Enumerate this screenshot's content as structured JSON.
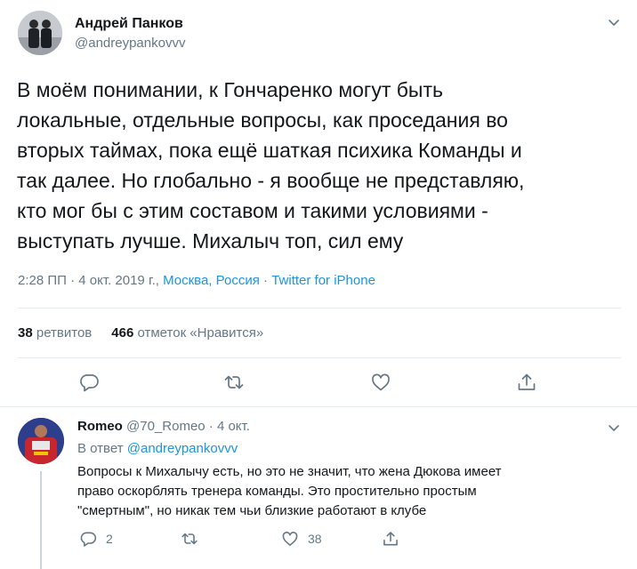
{
  "tweet": {
    "author_name": "Андрей Панков",
    "author_handle": "@andreypankovvv",
    "text": "В моём понимании, к Гончаренко могут быть\nлокальные, отдельные вопросы, как проседания во\nвторых таймах, пока ещё шаткая психика Команды и\nтак далее. Но глобально - я вообще не представляю,\nкто мог бы с этим составом и такими условиями -\nвыступать лучше. Михалыч топ, сил ему",
    "time": "2:28 ПП",
    "dot1": " · ",
    "date": "4 окт. 2019 г.,",
    "location": "Москва, Россия",
    "dot2": " · ",
    "source": "Twitter for iPhone",
    "retweets_count": "38",
    "retweets_label": "ретвитов",
    "likes_count": "466",
    "likes_label": "отметок «Нравится»"
  },
  "reply": {
    "author_name": "Romeo",
    "author_handle": "@70_Romeo",
    "date": "· 4 окт.",
    "in_reply_prefix": "В ответ",
    "in_reply_handle": "@andreypankovvv",
    "text": "Вопросы к Михалычу есть, но это не значит, что жена Дюкова имеет\nправо оскорблять тренера команды. Это простительно простым\n\"смертным\", но никак тем чьи близкие работают в клубе",
    "reply_count": "2",
    "like_count": "38"
  },
  "colors": {
    "link": "#1b95e0",
    "secondary_text": "#657786",
    "primary_text": "#14171a",
    "divider": "#e6ecf0"
  },
  "icons": [
    "caret-down-icon",
    "reply-icon",
    "retweet-icon",
    "like-icon",
    "share-icon"
  ]
}
